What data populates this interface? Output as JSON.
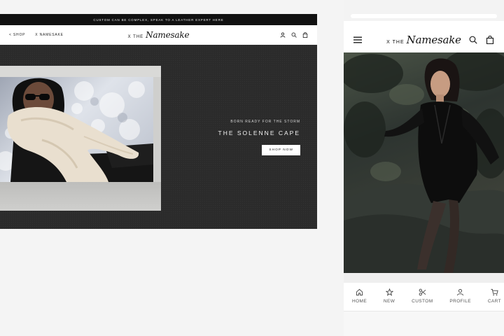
{
  "desktop": {
    "announcement": "CUSTOM CAN BE COMPLEX, SPEAK TO A LEATHER EXPERT HERE",
    "nav_links": [
      "< SHOP",
      "X NAMESAKE"
    ],
    "logo_prefix": "X THE",
    "logo_script": "Namesake",
    "icons": [
      "user-icon",
      "search-icon",
      "bag-icon"
    ],
    "hero": {
      "eyebrow": "BORN READY FOR THE STORM",
      "title": "THE SOLENNE CAPE",
      "cta": "SHOP NOW"
    }
  },
  "mobile": {
    "logo_prefix": "X THE",
    "logo_script": "Namesake",
    "icons": [
      "menu-icon",
      "search-icon",
      "bag-icon"
    ],
    "tabs": [
      {
        "label": "HOME",
        "icon": "home-icon"
      },
      {
        "label": "NEW",
        "icon": "star-icon"
      },
      {
        "label": "CUSTOM",
        "icon": "scissors-icon"
      },
      {
        "label": "PROFILE",
        "icon": "user-icon"
      },
      {
        "label": "CART",
        "icon": "cart-icon"
      }
    ]
  },
  "colors": {
    "background": "#f4f4f4",
    "announcement_bar": "#111111",
    "hero_bg": "#2b2b2b",
    "button_bg": "#ffffff"
  }
}
